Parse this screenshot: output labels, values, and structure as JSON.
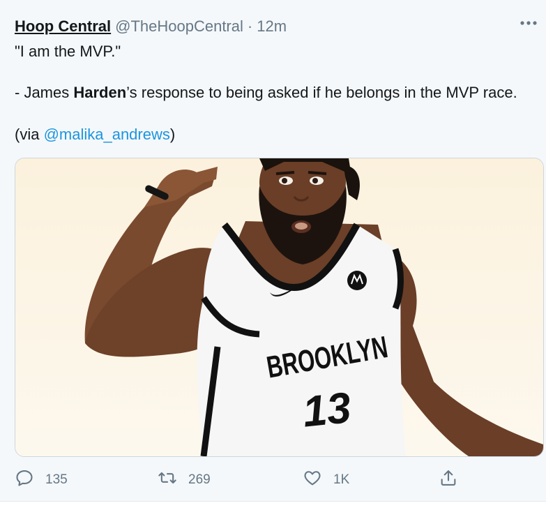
{
  "tweet": {
    "display_name": "Hoop Central",
    "handle": "@TheHoopCentral",
    "separator": "·",
    "time": "12m",
    "line1": "\"I am the MVP.\"",
    "line2_prefix": "- James ",
    "line2_bold": "Harden",
    "line2_suffix": "’s response to being asked if he belongs in the MVP race.",
    "line3_prefix": "(via ",
    "mention": "@malika_andrews",
    "line3_suffix": ")",
    "more_icon": "more-dots-icon"
  },
  "media": {
    "jersey_text": "BROOKLYN",
    "jersey_number": "13"
  },
  "actions": {
    "reply": {
      "icon": "reply-icon",
      "count": "135"
    },
    "retweet": {
      "icon": "retweet-icon",
      "count": "269"
    },
    "like": {
      "icon": "heart-icon",
      "count": "1K"
    },
    "share": {
      "icon": "share-icon"
    }
  },
  "colors": {
    "background": "#f5f8fa",
    "text": "#14171a",
    "secondary": "#657786",
    "link": "#1b95e0"
  }
}
